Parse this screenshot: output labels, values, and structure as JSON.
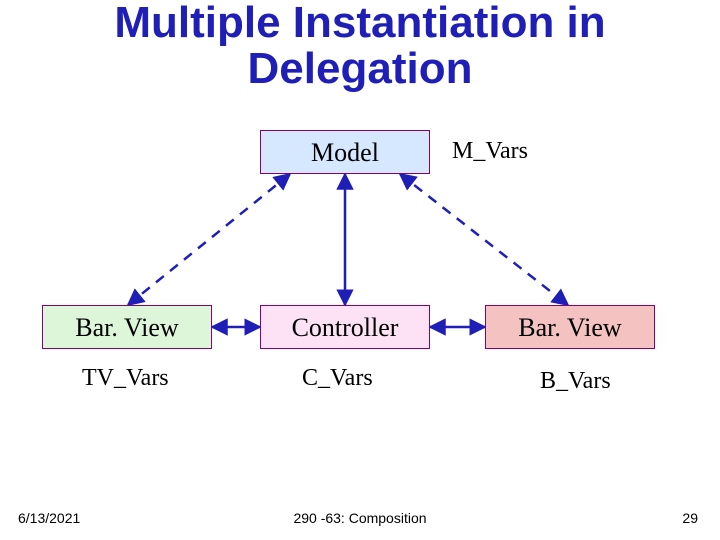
{
  "title": "Multiple Instantiation in Delegation",
  "nodes": {
    "model": "Model",
    "controller": "Controller",
    "barview_left": "Bar. View",
    "barview_right": "Bar. View"
  },
  "vars": {
    "m": "M_Vars",
    "tv": "TV_Vars",
    "c": "C_Vars",
    "b": "B_Vars"
  },
  "footer": {
    "date": "6/13/2021",
    "center": "290 -63: Composition",
    "page": "29"
  },
  "colors": {
    "title": "#1f1fb8",
    "model_fill": "#d6e8ff",
    "controller_fill": "#fce2f4",
    "barview_left_fill": "#ddf6d9",
    "barview_right_fill": "#f5c2c2",
    "border": "#800080",
    "line": "#1f1fb8"
  }
}
